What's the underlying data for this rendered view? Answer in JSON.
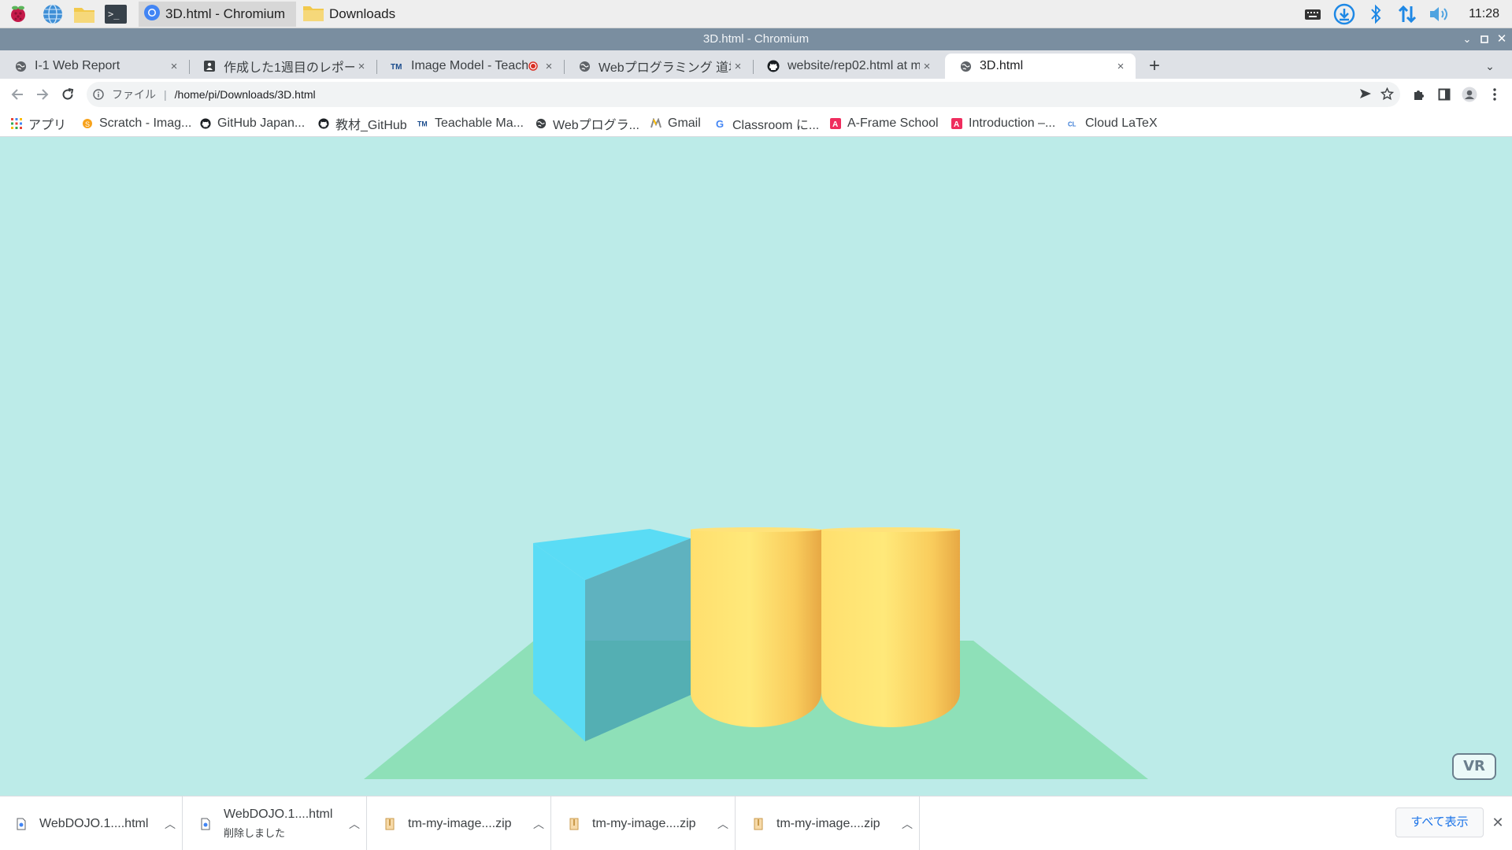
{
  "taskbar": {
    "tasks": [
      {
        "label": "3D.html - Chromium",
        "icon": "chromium-icon"
      },
      {
        "label": "Downloads",
        "icon": "folder-icon"
      }
    ],
    "clock": "11:28",
    "colors": {
      "bluetooth": "#1e88e5",
      "volume": "#4fa3e0"
    }
  },
  "window": {
    "title": "3D.html - Chromium"
  },
  "tabs": [
    {
      "title": "I-1 Web Report",
      "icon": "globe-icon"
    },
    {
      "title": "作成した1週目のレポー",
      "icon": "document-icon"
    },
    {
      "title": "Image Model - Teach",
      "icon": "teachable-machine-icon",
      "recording": true
    },
    {
      "title": "Webプログラミング 道場",
      "icon": "globe-icon"
    },
    {
      "title": "website/rep02.html at m",
      "icon": "github-icon"
    },
    {
      "title": "3D.html",
      "icon": "globe-icon",
      "active": true
    }
  ],
  "new_tab_symbol": "+",
  "tab_close_symbol": "×",
  "address": {
    "scheme_label": "ファイル",
    "url": "/home/pi/Downloads/3D.html"
  },
  "bookmarks": [
    {
      "label": "アプリ",
      "icon": "apps-grid-icon"
    },
    {
      "label": "Scratch - Imag...",
      "icon": "scratch-icon"
    },
    {
      "label": "GitHub Japan...",
      "icon": "github-icon"
    },
    {
      "label": "教材_GitHub",
      "icon": "github-icon"
    },
    {
      "label": "Teachable Ma...",
      "icon": "teachable-machine-icon"
    },
    {
      "label": "Webプログラ...",
      "icon": "globe-icon"
    },
    {
      "label": "Gmail",
      "icon": "gmail-icon"
    },
    {
      "label": "Classroom に...",
      "icon": "google-icon"
    },
    {
      "label": "A-Frame School",
      "icon": "aframe-icon"
    },
    {
      "label": "Introduction –...",
      "icon": "aframe-icon"
    },
    {
      "label": "Cloud LaTeX",
      "icon": "cloud-latex-icon"
    }
  ],
  "scene": {
    "sky_color": "#bcebe8",
    "ground_color": "#8ee0b8",
    "box_color": "#5adcf5",
    "cylinder_color": "#ffd966",
    "vr_label": "VR"
  },
  "downloads": {
    "items": [
      {
        "name": "WebDOJO.1....html",
        "status": "",
        "icon": "html-file-icon"
      },
      {
        "name": "WebDOJO.1....html",
        "status": "削除しました",
        "icon": "html-file-icon"
      },
      {
        "name": "tm-my-image....zip",
        "status": "",
        "icon": "zip-file-icon"
      },
      {
        "name": "tm-my-image....zip",
        "status": "",
        "icon": "zip-file-icon"
      },
      {
        "name": "tm-my-image....zip",
        "status": "",
        "icon": "zip-file-icon"
      }
    ],
    "show_all_label": "すべて表示"
  }
}
